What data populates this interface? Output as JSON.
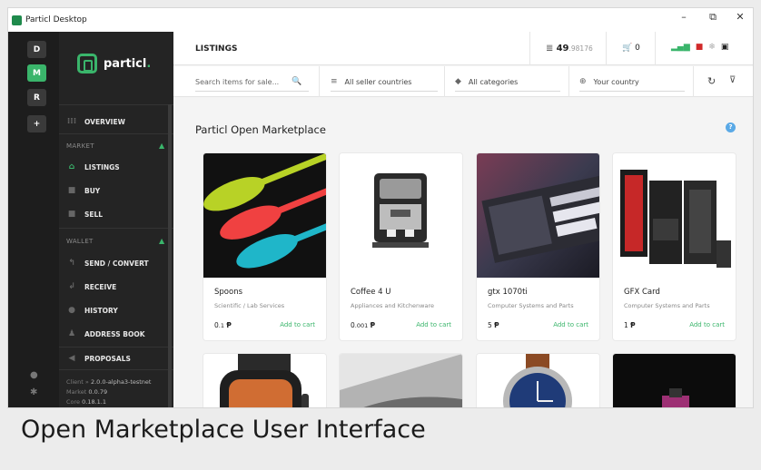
{
  "window": {
    "title": "Particl Desktop",
    "controls": [
      "–",
      "⧉",
      "✕"
    ]
  },
  "rail": {
    "buttons": [
      "D",
      "M",
      "R",
      "+"
    ]
  },
  "brand": {
    "name": "particl",
    "dot": "."
  },
  "nav": {
    "overview": "OVERVIEW",
    "market_section": "MARKET",
    "listings": "LISTINGS",
    "buy": "BUY",
    "sell": "SELL",
    "wallet_section": "WALLET",
    "send": "SEND / CONVERT",
    "receive": "RECEIVE",
    "history": "HISTORY",
    "address_book": "ADDRESS BOOK",
    "proposals": "PROPOSALS"
  },
  "version": {
    "client_label": "Client",
    "client_value": "2.0.0-alpha3-testnet",
    "market_label": "Market",
    "market_value": "0.0.79",
    "core_label": "Core",
    "core_value": "0.18.1.1"
  },
  "header": {
    "title": "LISTINGS",
    "balance_int": "49",
    "balance_dec": ".98176",
    "cart_count": "0"
  },
  "filters": {
    "search_placeholder": "Search items for sale...",
    "countries": "All seller countries",
    "categories": "All categories",
    "your_country": "Your country"
  },
  "market": {
    "title": "Particl Open Marketplace",
    "listings": [
      {
        "title": "Spoons",
        "category": "Scientific / Lab Services",
        "price_int": "0",
        "price_dec": ".1",
        "currency": "Ᵽ",
        "action": "Add to cart"
      },
      {
        "title": "Coffee 4 U",
        "category": "Appliances and Kitchenware",
        "price_int": "0",
        "price_dec": ".001",
        "currency": "Ᵽ",
        "action": "Add to cart"
      },
      {
        "title": "gtx 1070ti",
        "category": "Computer Systems and Parts",
        "price_int": "5",
        "price_dec": "",
        "currency": "Ᵽ",
        "action": "Add to cart"
      },
      {
        "title": "GFX Card",
        "category": "Computer Systems and Parts",
        "price_int": "1",
        "price_dec": "",
        "currency": "Ᵽ",
        "action": "Add to cart"
      }
    ]
  },
  "caption": "Open Marketplace User Interface",
  "colors": {
    "accent": "#3ab56b",
    "sidebar": "#242424",
    "rail": "#1d1d1d"
  }
}
